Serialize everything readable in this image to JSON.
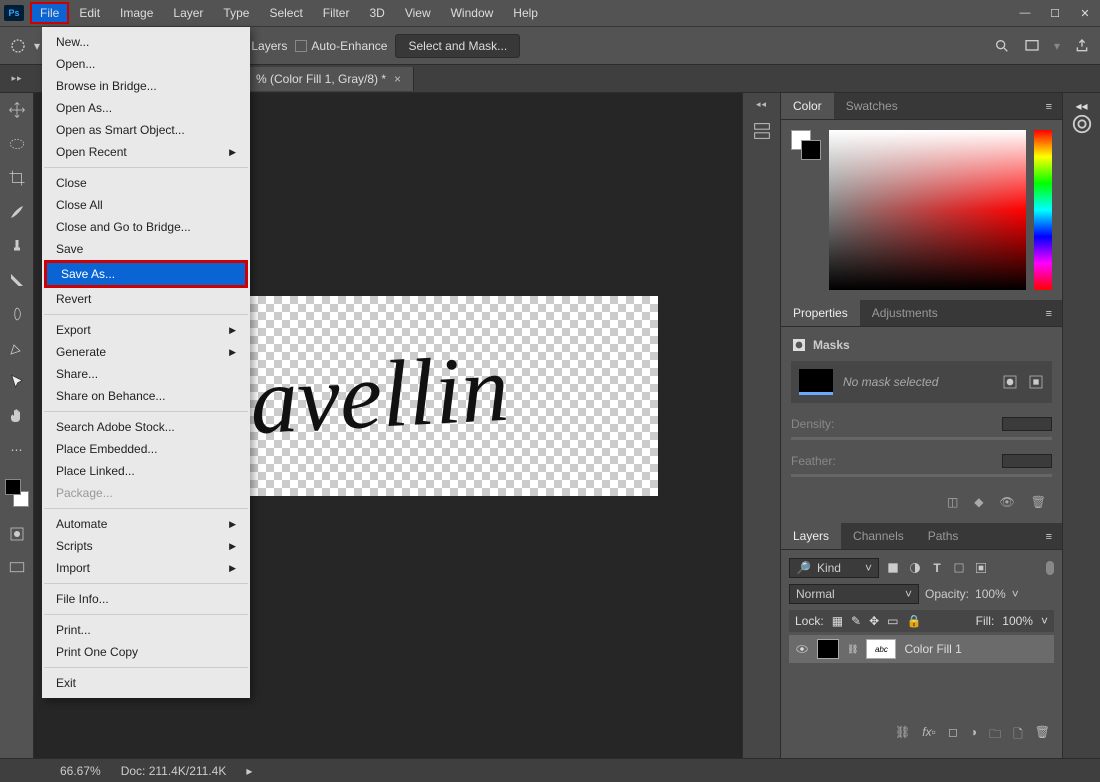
{
  "menubar": {
    "items": [
      "File",
      "Edit",
      "Image",
      "Layer",
      "Type",
      "Select",
      "Filter",
      "3D",
      "View",
      "Window",
      "Help"
    ],
    "active_index": 0
  },
  "options": {
    "sample": "mple All Layers",
    "enhance": "Auto-Enhance",
    "mask_btn": "Select and Mask..."
  },
  "doctab": {
    "title": "% (Color Fill 1, Gray/8) *"
  },
  "file_menu": {
    "groups": [
      [
        {
          "l": "New..."
        },
        {
          "l": "Open..."
        },
        {
          "l": "Browse in Bridge..."
        },
        {
          "l": "Open As..."
        },
        {
          "l": "Open as Smart Object..."
        },
        {
          "l": "Open Recent",
          "sub": true
        }
      ],
      [
        {
          "l": "Close"
        },
        {
          "l": "Close All"
        },
        {
          "l": "Close and Go to Bridge..."
        },
        {
          "l": "Save"
        },
        {
          "l": "Save As...",
          "hl": true
        },
        {
          "l": "Revert"
        }
      ],
      [
        {
          "l": "Export",
          "sub": true
        },
        {
          "l": "Generate",
          "sub": true
        },
        {
          "l": "Share..."
        },
        {
          "l": "Share on Behance..."
        }
      ],
      [
        {
          "l": "Search Adobe Stock..."
        },
        {
          "l": "Place Embedded..."
        },
        {
          "l": "Place Linked..."
        },
        {
          "l": "Package...",
          "dis": true
        }
      ],
      [
        {
          "l": "Automate",
          "sub": true
        },
        {
          "l": "Scripts",
          "sub": true
        },
        {
          "l": "Import",
          "sub": true
        }
      ],
      [
        {
          "l": "File Info..."
        }
      ],
      [
        {
          "l": "Print..."
        },
        {
          "l": "Print One Copy"
        }
      ],
      [
        {
          "l": "Exit"
        }
      ]
    ]
  },
  "signature": "Ravellin",
  "panels": {
    "color": {
      "tabs": [
        "Color",
        "Swatches"
      ],
      "active": 0
    },
    "props": {
      "tabs": [
        "Properties",
        "Adjustments"
      ],
      "active": 0,
      "title": "Masks",
      "nomask": "No mask selected",
      "density": "Density:",
      "feather": "Feather:"
    },
    "layers": {
      "tabs": [
        "Layers",
        "Channels",
        "Paths"
      ],
      "active": 0,
      "kind": "Kind",
      "blend": "Normal",
      "opacity_l": "Opacity:",
      "opacity_v": "100%",
      "lock": "Lock:",
      "fill_l": "Fill:",
      "fill_v": "100%",
      "layer1": "Color Fill 1"
    }
  },
  "status": {
    "zoom": "66.67%",
    "doc": "Doc: 211.4K/211.4K"
  }
}
